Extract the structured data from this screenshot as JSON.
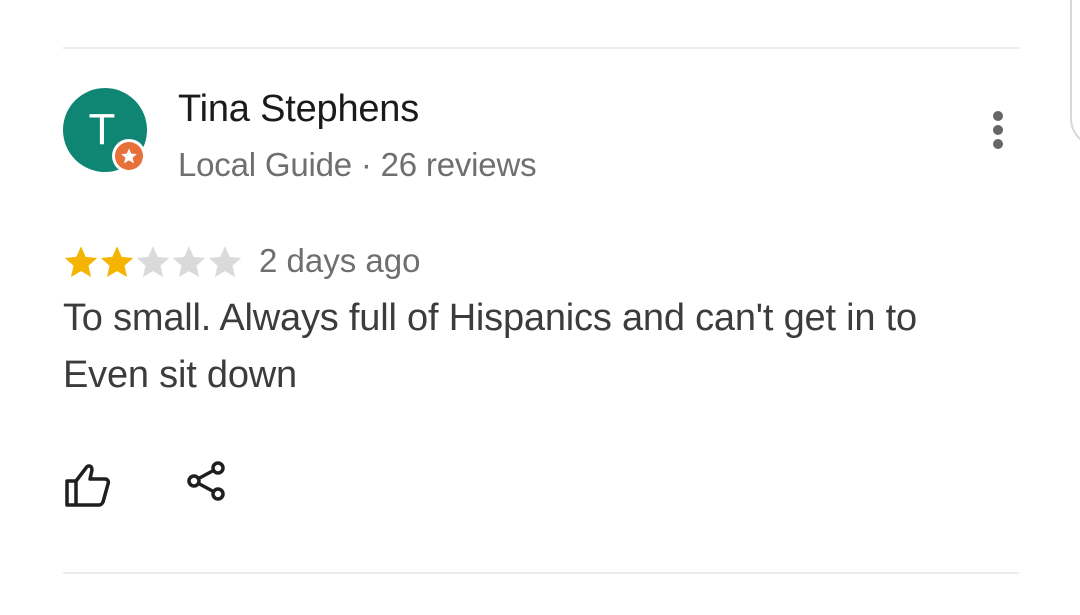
{
  "review": {
    "author": {
      "initial": "T",
      "name": "Tina Stephens",
      "meta": "Local Guide · 26 reviews",
      "avatar_color": "#0f8574",
      "badge_color": "#e8713a"
    },
    "rating": {
      "value": 2,
      "max": 5
    },
    "time": "2 days ago",
    "text": "To small. Always full of Hispanics and can't get in to Even sit down",
    "actions": {
      "like_icon": "thumb-up-icon",
      "share_icon": "share-icon",
      "more_icon": "more-vert-icon"
    }
  },
  "colors": {
    "star_filled": "#f4b400",
    "star_empty": "#dadada"
  }
}
